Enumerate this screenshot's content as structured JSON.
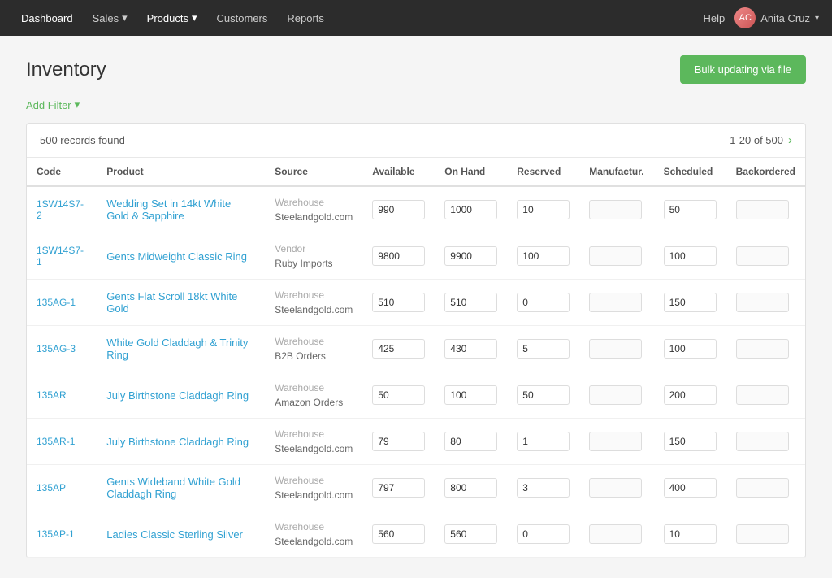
{
  "nav": {
    "brand": "Dashboard",
    "items": [
      {
        "label": "Sales",
        "hasDropdown": true
      },
      {
        "label": "Products",
        "hasDropdown": true
      },
      {
        "label": "Customers",
        "hasDropdown": false
      },
      {
        "label": "Reports",
        "hasDropdown": false
      }
    ],
    "help": "Help",
    "user": "Anita Cruz"
  },
  "page": {
    "title": "Inventory",
    "bulkUpdateBtn": "Bulk updating via file"
  },
  "filter": {
    "addFilterLabel": "Add Filter"
  },
  "table": {
    "recordsFound": "500 records found",
    "pagination": "1-20 of 500",
    "columns": [
      "Code",
      "Product",
      "Source",
      "Available",
      "On Hand",
      "Reserved",
      "Manufactur.",
      "Scheduled",
      "Backordered"
    ],
    "rows": [
      {
        "code": "1SW14S7-2",
        "product": "Wedding Set in 14kt White Gold & Sapphire",
        "sourceType": "Warehouse",
        "sourceName": "Steelandgold.com",
        "available": "990",
        "onHand": "1000",
        "reserved": "10",
        "manufactur": "",
        "scheduled": "50",
        "backordered": ""
      },
      {
        "code": "1SW14S7-1",
        "product": "Gents Midweight Classic Ring",
        "sourceType": "Vendor",
        "sourceName": "Ruby Imports",
        "available": "9800",
        "onHand": "9900",
        "reserved": "100",
        "manufactur": "",
        "scheduled": "100",
        "backordered": ""
      },
      {
        "code": "135AG-1",
        "product": "Gents Flat Scroll 18kt White Gold",
        "sourceType": "Warehouse",
        "sourceName": "Steelandgold.com",
        "available": "510",
        "onHand": "510",
        "reserved": "0",
        "manufactur": "",
        "scheduled": "150",
        "backordered": ""
      },
      {
        "code": "135AG-3",
        "product": "White Gold Claddagh & Trinity Ring",
        "sourceType": "Warehouse",
        "sourceName": "B2B Orders",
        "available": "425",
        "onHand": "430",
        "reserved": "5",
        "manufactur": "",
        "scheduled": "100",
        "backordered": ""
      },
      {
        "code": "135AR",
        "product": "July Birthstone Claddagh Ring",
        "sourceType": "Warehouse",
        "sourceName": "Amazon Orders",
        "available": "50",
        "onHand": "100",
        "reserved": "50",
        "manufactur": "",
        "scheduled": "200",
        "backordered": ""
      },
      {
        "code": "135AR-1",
        "product": "July Birthstone Claddagh Ring",
        "sourceType": "Warehouse",
        "sourceName": "Steelandgold.com",
        "available": "79",
        "onHand": "80",
        "reserved": "1",
        "manufactur": "",
        "scheduled": "150",
        "backordered": ""
      },
      {
        "code": "135AP",
        "product": "Gents Wideband White Gold Claddagh Ring",
        "sourceType": "Warehouse",
        "sourceName": "Steelandgold.com",
        "available": "797",
        "onHand": "800",
        "reserved": "3",
        "manufactur": "",
        "scheduled": "400",
        "backordered": ""
      },
      {
        "code": "135AP-1",
        "product": "Ladies Classic Sterling Silver",
        "sourceType": "Warehouse",
        "sourceName": "Steelandgold.com",
        "available": "560",
        "onHand": "560",
        "reserved": "0",
        "manufactur": "",
        "scheduled": "10",
        "backordered": ""
      }
    ]
  }
}
